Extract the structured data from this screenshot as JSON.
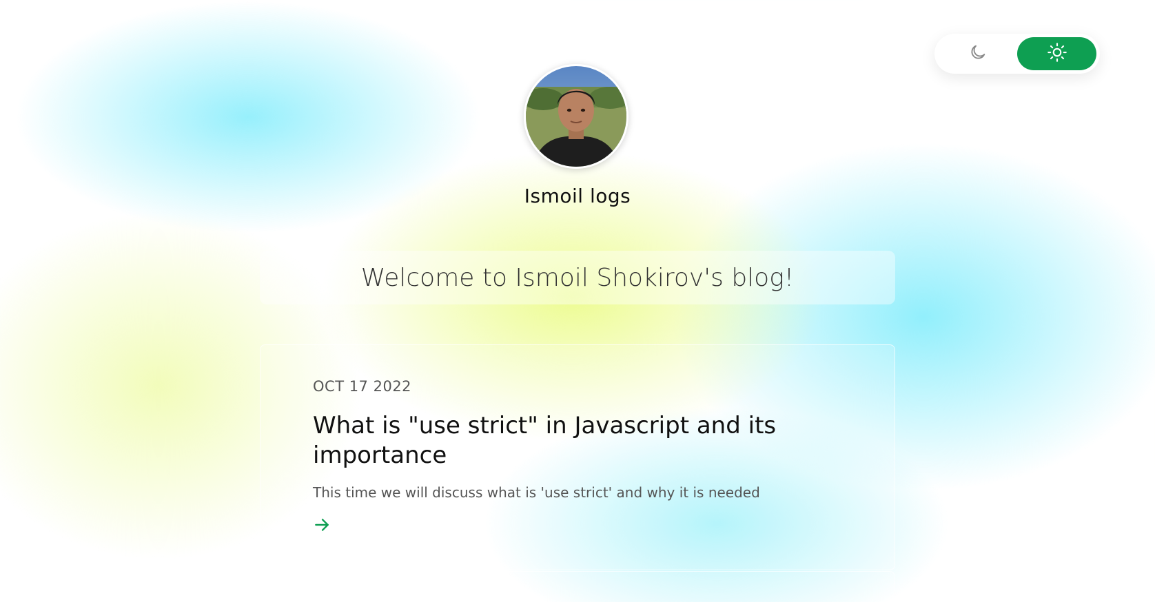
{
  "theme_toggle": {
    "options": [
      {
        "name": "dark",
        "icon": "moon-icon",
        "active": false
      },
      {
        "name": "light",
        "icon": "sun-icon",
        "active": true
      }
    ],
    "active_color": "#0e9f52"
  },
  "header": {
    "avatar_icon": "avatar",
    "blog_name": "Ismoil logs"
  },
  "welcome": {
    "text": "Welcome to Ismoil Shokirov's blog!"
  },
  "posts": [
    {
      "date": "OCT 17 2022",
      "title": "What is \"use strict\" in Javascript and its importance",
      "excerpt": "This time we will discuss what is 'use strict' and why it is needed",
      "link_icon": "arrow-right-icon"
    }
  ],
  "colors": {
    "accent": "#0e9f52",
    "title_text": "#111111",
    "muted_text": "#555555"
  }
}
